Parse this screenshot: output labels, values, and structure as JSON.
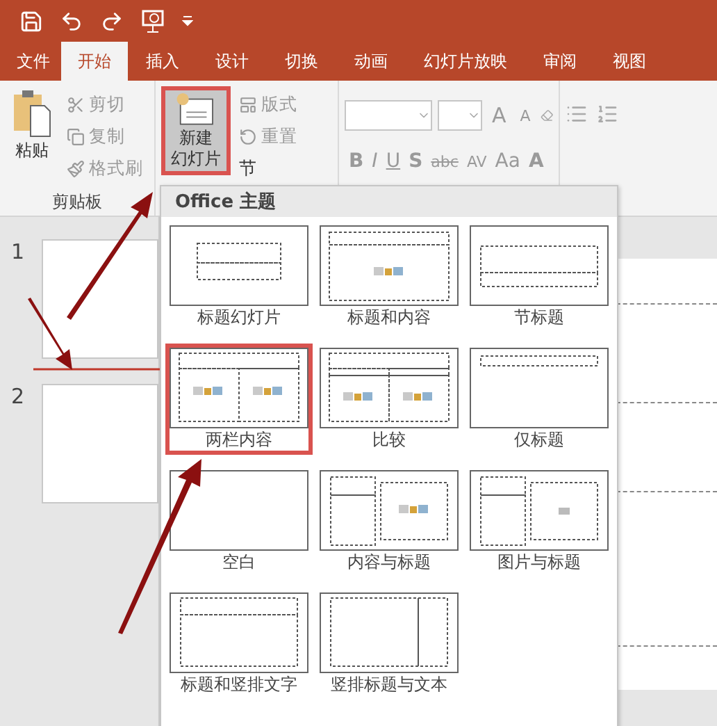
{
  "tabs": [
    {
      "label": "文件",
      "selected": false
    },
    {
      "label": "开始",
      "selected": true
    },
    {
      "label": "插入",
      "selected": false
    },
    {
      "label": "设计",
      "selected": false
    },
    {
      "label": "切换",
      "selected": false
    },
    {
      "label": "动画",
      "selected": false
    },
    {
      "label": "幻灯片放映",
      "selected": false
    },
    {
      "label": "审阅",
      "selected": false
    },
    {
      "label": "视图",
      "selected": false
    }
  ],
  "clipboard": {
    "paste": "粘贴",
    "cut": "剪切",
    "copy": "复制",
    "painter": "格式刷",
    "group_label": "剪贴板"
  },
  "slides_group": {
    "new_slide_lines": [
      "新建",
      "幻灯片"
    ],
    "new_slide_annotated": true,
    "layout": "版式",
    "reset": "重置",
    "section": "节"
  },
  "font_buttons": [
    {
      "label": "B",
      "kind": "bold"
    },
    {
      "label": "I",
      "kind": "italic"
    },
    {
      "label": "U",
      "kind": "underline"
    },
    {
      "label": "S",
      "kind": "shadow"
    },
    {
      "label": "abc",
      "kind": "strike"
    },
    {
      "label": "AV",
      "kind": "spacing"
    },
    {
      "label": "Aa",
      "kind": "case"
    },
    {
      "label": "A",
      "kind": "color"
    }
  ],
  "size_buttons": [
    {
      "label": "A",
      "kind": "grow"
    },
    {
      "label": "A",
      "kind": "shrink"
    }
  ],
  "gallery": {
    "title": "Office 主题",
    "layouts": [
      {
        "label": "标题幻灯片",
        "kind": "title",
        "annotated": false
      },
      {
        "label": "标题和内容",
        "kind": "title_content",
        "annotated": false
      },
      {
        "label": "节标题",
        "kind": "section",
        "annotated": false
      },
      {
        "label": "两栏内容",
        "kind": "two_content",
        "annotated": true
      },
      {
        "label": "比较",
        "kind": "comparison",
        "annotated": false
      },
      {
        "label": "仅标题",
        "kind": "title_only",
        "annotated": false
      },
      {
        "label": "空白",
        "kind": "blank",
        "annotated": false
      },
      {
        "label": "内容与标题",
        "kind": "content_caption",
        "annotated": false
      },
      {
        "label": "图片与标题",
        "kind": "picture_caption",
        "annotated": false
      },
      {
        "label": "标题和竖排文字",
        "kind": "vertical_text",
        "annotated": false
      },
      {
        "label": "竖排标题与文本",
        "kind": "vertical_title",
        "annotated": false
      }
    ]
  },
  "slide_panel": {
    "slides": [
      {
        "number": "1"
      },
      {
        "number": "2"
      }
    ]
  }
}
